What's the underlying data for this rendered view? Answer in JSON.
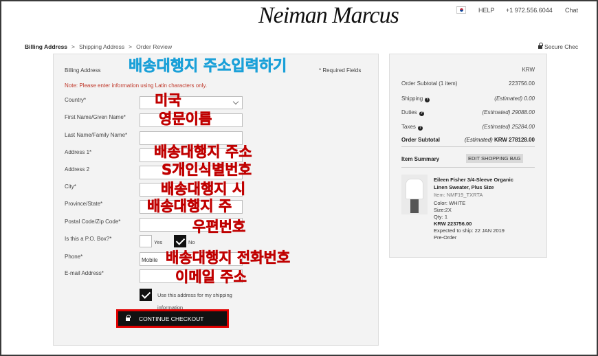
{
  "header": {
    "logo": "Neiman Marcus",
    "help": "HELP",
    "phone": "+1 972.556.6044",
    "chat": "Chat"
  },
  "breadcrumb": {
    "step1": "Billing Address",
    "step2": "Shipping Address",
    "step3": "Order Review",
    "separator": ">",
    "secure": "Secure Chec"
  },
  "form": {
    "section_title": "Billing Address",
    "required_note": "* Required Fields",
    "latin_note": "Note: Please enter information using Latin characters only.",
    "labels": {
      "country": "Country*",
      "first_name": "First Name/Given Name*",
      "last_name": "Last Name/Family Name*",
      "address1": "Address 1*",
      "address2": "Address 2",
      "city": "City*",
      "province": "Province/State*",
      "postal": "Postal Code/Zip Code*",
      "po_box": "Is this a P.O. Box?*",
      "phone": "Phone*",
      "email": "E-mail Address*"
    },
    "po_yes": "Yes",
    "po_no": "No",
    "phone_type": "Mobile",
    "shipping_same_line1": "Use this address for my shipping",
    "shipping_same_line2": "information",
    "continue_button": "CONTINUE CHECKOUT"
  },
  "annotations": {
    "title": "배송대행지 주소입력하기",
    "country": "미국",
    "name": "영문이름",
    "address1": "배송대행지 주소",
    "address2": "S개인식별번호",
    "city": "배송대행지 시",
    "province": "배송대행지 주",
    "postal": "우편번호",
    "phone": "배송대행지 전화번호",
    "email": "이메일 주소"
  },
  "summary": {
    "currency": "KRW",
    "order_subtotal_label": "Order Subtotal (1 item)",
    "order_subtotal_value": "223756.00",
    "shipping_label": "Shipping",
    "shipping_value": "(Estimated) 0.00",
    "duties_label": "Duties",
    "duties_value": "(Estimated) 29088.00",
    "taxes_label": "Taxes",
    "taxes_value": "(Estimated) 25284.00",
    "total_label": "Order Subtotal",
    "total_est": "(Estimated)",
    "total_value": "KRW 278128.00",
    "item_summary": "Item Summary",
    "edit_bag": "EDIT SHOPPING BAG"
  },
  "product": {
    "name_line1": "Eileen Fisher 3/4-Sleeve Organic",
    "name_line2": "Linen Sweater, Plus Size",
    "item": "Item: NMF19_TXRTA",
    "color": "Color: WHITE",
    "size": "Size:2X",
    "qty": "Qty: 1",
    "price": "KRW 223756.00",
    "ship_date": "Expected to ship: 22 JAN 2019",
    "status": "Pre-Order"
  }
}
